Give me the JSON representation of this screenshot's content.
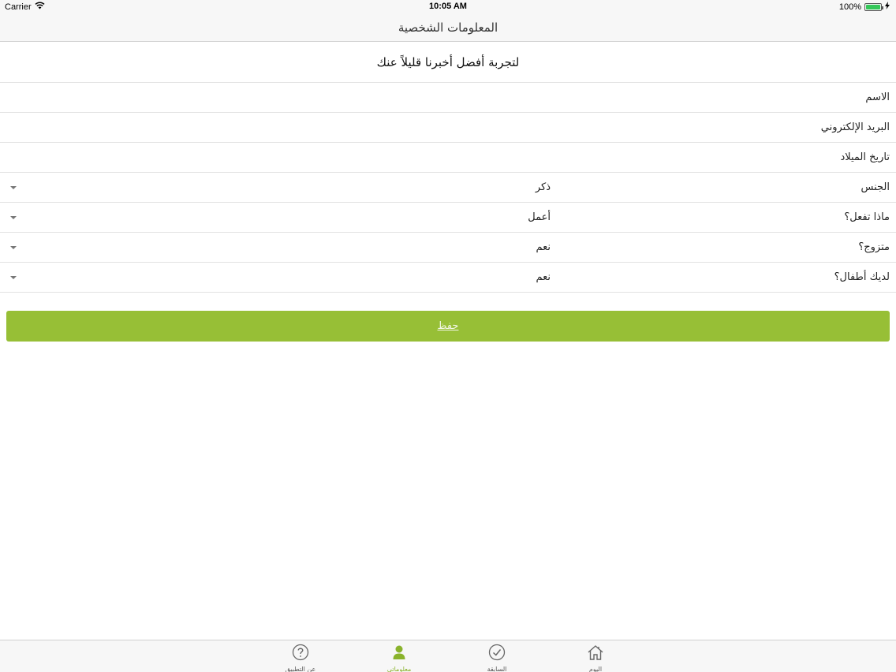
{
  "status_bar": {
    "carrier": "Carrier",
    "time": "10:05 AM",
    "battery": "100%",
    "battery_level": 1.0,
    "icons": [
      "wifi-icon",
      "battery-icon",
      "charging-icon"
    ]
  },
  "nav": {
    "title": "المعلومات الشخصية"
  },
  "intro": {
    "text": "لتجربة أفضل أخبرنا قليلاً عنك"
  },
  "form": {
    "name_label": "الاسم",
    "email_label": "البريد الإلكتروني",
    "birthdate_label": "تاريخ الميلاد",
    "gender_label": "الجنس",
    "gender_value": "ذكر",
    "occupation_label": "ماذا تفعل؟",
    "occupation_value": "أعمل",
    "married_label": "متزوج؟",
    "married_value": "نعم",
    "children_label": "لديك أطفال؟",
    "children_value": "نعم"
  },
  "save_label": "حفظ",
  "tabs": [
    {
      "label": "اليوم",
      "icon": "home-icon",
      "active": false
    },
    {
      "label": "السابقة",
      "icon": "checkmark-circle-icon",
      "active": false
    },
    {
      "label": "معلوماتي",
      "icon": "person-icon",
      "active": true
    },
    {
      "label": "عن التطبيق",
      "icon": "question-circle-icon",
      "active": false
    }
  ],
  "colors": {
    "accent": "#97bf36",
    "active_tab": "#8ab32c"
  }
}
